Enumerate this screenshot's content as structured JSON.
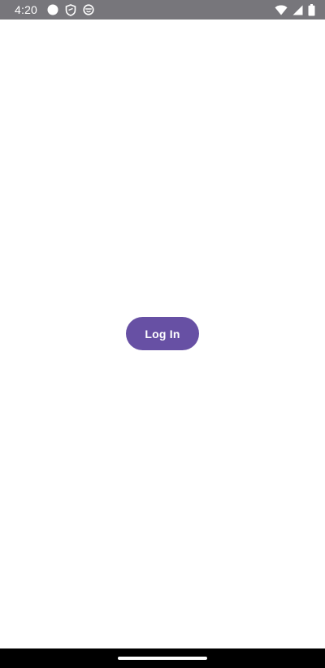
{
  "status_bar": {
    "time": "4:20",
    "left_icons": [
      "circle-notification-icon",
      "shield-icon",
      "smiley-icon"
    ],
    "right_icons": [
      "wifi-icon",
      "cell-signal-icon",
      "battery-icon"
    ],
    "background": "#77767b"
  },
  "main": {
    "login_button_label": "Log In",
    "accent_color": "#6750a4"
  }
}
